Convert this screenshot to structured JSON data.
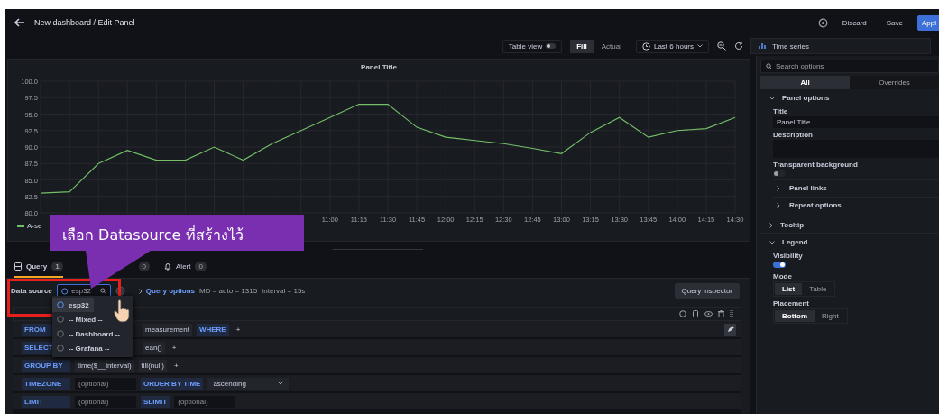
{
  "header": {
    "title": "New dashboard / Edit Panel",
    "buttons": [
      {
        "label": "Discard",
        "kind": "plain"
      },
      {
        "label": "Save",
        "kind": "plain"
      },
      {
        "label": "Appl",
        "kind": "primary"
      }
    ]
  },
  "toolbar": {
    "table_view": {
      "label": "Table view",
      "on": false
    },
    "fit_modes": [
      {
        "label": "Fill",
        "selected": true
      },
      {
        "label": "Actual",
        "selected": false
      }
    ],
    "time_range": "Last 6 hours",
    "visualization": "Time series"
  },
  "panel": {
    "title": "Panel Title",
    "chart_data": {
      "type": "line",
      "grid": true,
      "categories": [
        null,
        null,
        null,
        null,
        null,
        null,
        null,
        null,
        null,
        null,
        "11:00",
        "11:15",
        "11:30",
        "11:45",
        "12:00",
        "12:15",
        "12:30",
        "12:45",
        "13:00",
        "13:15",
        "13:30",
        "13:45",
        "14:00",
        "14:15",
        "14:30"
      ],
      "series": [
        {
          "name": "A-se",
          "color": "#73bf69",
          "values": [
            83,
            83.2,
            87.5,
            89.5,
            88,
            88,
            90,
            88,
            90.5,
            92.5,
            94.5,
            96.5,
            96.5,
            93,
            91.5,
            91,
            90.5,
            89.8,
            89,
            92.2,
            94.5,
            91.5,
            92.5,
            92.8,
            94.5
          ]
        }
      ],
      "ylim": [
        80,
        100
      ],
      "yticks": [
        {
          "value": 80,
          "label": "80.0"
        },
        {
          "value": 82.5,
          "label": "82.5"
        },
        {
          "value": 85,
          "label": "85.0"
        },
        {
          "value": 87.5,
          "label": "87.5"
        },
        {
          "value": 90,
          "label": "90.0"
        },
        {
          "value": 92.5,
          "label": "92.5"
        },
        {
          "value": 95,
          "label": "95.0"
        },
        {
          "value": 97.5,
          "label": "97.5"
        },
        {
          "value": 100,
          "label": "100.0"
        }
      ]
    }
  },
  "callout": {
    "text": "เลือก Datasource ที่สร้างไว้"
  },
  "query_tabs": [
    {
      "kind": "query",
      "label": "Query",
      "count": "1",
      "selected": true
    },
    {
      "kind": "transform",
      "count": "0",
      "selected": false
    },
    {
      "kind": "alert",
      "label": "Alert",
      "count": "0",
      "selected": false
    }
  ],
  "data_source": {
    "label": "Data source",
    "value": "esp32",
    "query_options": "Query options",
    "info": [
      "MD = auto = 1315",
      "Interval = 15s"
    ],
    "inspector": "Query inspector"
  },
  "dropdown": [
    {
      "label": "esp32",
      "selected": true
    },
    {
      "label": "-- Mixed --",
      "selected": false
    },
    {
      "label": "-- Dashboard --",
      "selected": false
    },
    {
      "label": "-- Grafana --",
      "selected": false
    }
  ],
  "editor_rows": [
    {
      "label": "FROM",
      "covered": true,
      "parts": [
        {
          "kind": "value",
          "text": "measurement"
        },
        {
          "kind": "keyword",
          "text": "WHERE"
        },
        {
          "kind": "plus",
          "text": "+"
        }
      ]
    },
    {
      "label": "SELECT",
      "covered": true,
      "parts": [
        {
          "kind": "value",
          "text": "ean()"
        },
        {
          "kind": "plus",
          "text": "+"
        }
      ]
    },
    {
      "label": "GROUP BY",
      "covered": false,
      "parts": [
        {
          "kind": "value",
          "text": "time($__interval)"
        },
        {
          "kind": "value",
          "text": "fill(null)"
        },
        {
          "kind": "plus",
          "text": "+"
        }
      ]
    },
    {
      "label": "TIMEZONE",
      "covered": false,
      "parts": [
        {
          "kind": "input",
          "placeholder": "(optional)"
        },
        {
          "kind": "keyword",
          "text": "ORDER BY TIME"
        },
        {
          "kind": "select",
          "text": "ascending"
        }
      ]
    },
    {
      "label": "LIMIT",
      "covered": false,
      "parts": [
        {
          "kind": "input",
          "placeholder": "(optional)"
        },
        {
          "kind": "keyword",
          "text": "SLIMIT"
        },
        {
          "kind": "input",
          "placeholder": "(optional)"
        }
      ]
    }
  ],
  "options": {
    "search_placeholder": "Search options",
    "tabs": [
      {
        "label": "All",
        "selected": true
      },
      {
        "label": "Overrides",
        "selected": false
      }
    ],
    "sections": [
      {
        "title": "Panel options",
        "expanded": true,
        "items": [
          {
            "kind": "input",
            "label": "Title",
            "value": "Panel Title"
          },
          {
            "kind": "textarea",
            "label": "Description"
          },
          {
            "kind": "switch",
            "label": "Transparent background",
            "on": false
          },
          {
            "kind": "subsection",
            "title": "Panel links",
            "expanded": false
          },
          {
            "kind": "subsection",
            "title": "Repeat options",
            "expanded": false
          }
        ]
      },
      {
        "title": "Tooltip",
        "expanded": false
      },
      {
        "title": "Legend",
        "expanded": true,
        "items": [
          {
            "kind": "switch",
            "label": "Visibility",
            "on": true
          },
          {
            "kind": "radio",
            "label": "Mode",
            "options": [
              {
                "label": "List",
                "selected": true
              },
              {
                "label": "Table",
                "selected": false
              }
            ]
          },
          {
            "kind": "radio",
            "label": "Placement",
            "options": [
              {
                "label": "Bottom",
                "selected": true
              },
              {
                "label": "Right",
                "selected": false
              }
            ]
          }
        ]
      }
    ]
  }
}
